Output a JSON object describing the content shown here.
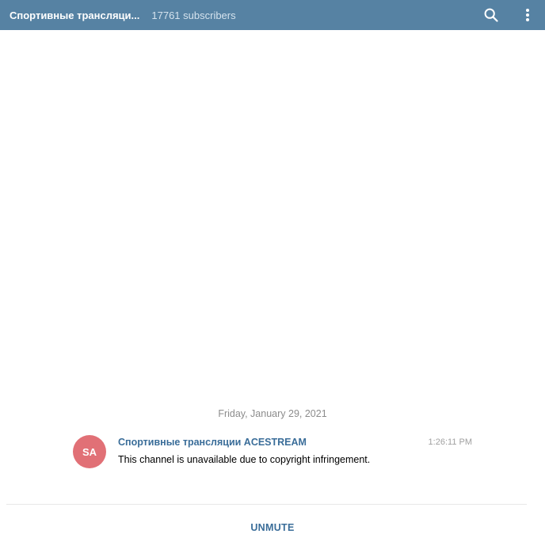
{
  "header": {
    "title": "Спортивные трансляци...",
    "subscribers": "17761 subscribers",
    "icons": [
      "search-icon",
      "more-vertical-icon"
    ],
    "background_color": "#5682a3"
  },
  "messages": {
    "date_separator": "Friday, January 29, 2021",
    "items": [
      {
        "avatar_initials": "SA",
        "avatar_color": "#e17076",
        "author": "Спортивные трансляции ACESTREAM",
        "time": "1:26:11 PM",
        "text": "This channel is unavailable due to copyright infringement."
      }
    ]
  },
  "footer": {
    "unmute_label": "UNMUTE",
    "accent_color": "#3a6d99"
  }
}
